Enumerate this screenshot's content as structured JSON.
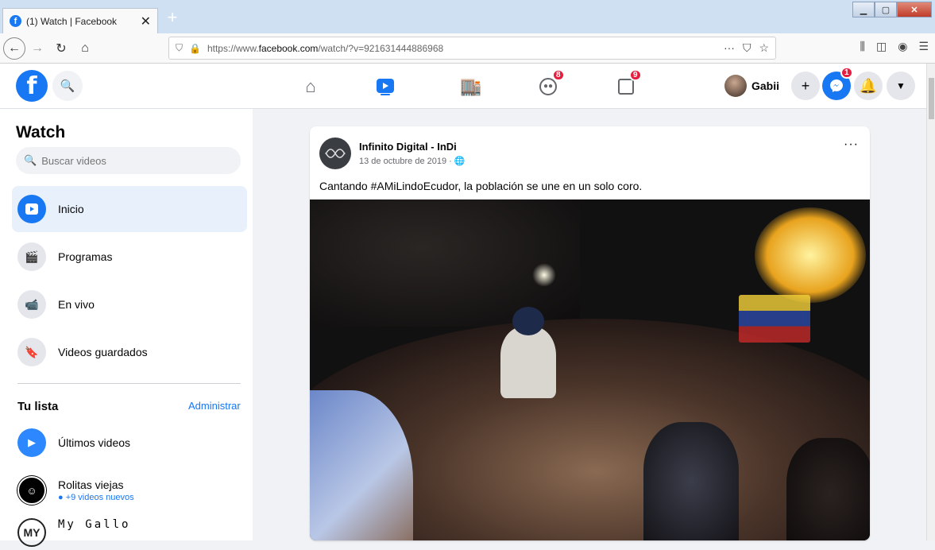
{
  "browser": {
    "tab_title": "(1) Watch | Facebook",
    "tab_close": "✕",
    "new_tab": "+",
    "url_prefix": "https://www.",
    "url_domain": "facebook.com",
    "url_path": "/watch/?v=921631444886968",
    "url_more": "···"
  },
  "fb": {
    "logo": "f",
    "profile_name": "Gabii",
    "badges": {
      "groups": "8",
      "gaming": "9",
      "messenger": "1"
    }
  },
  "sidebar": {
    "title": "Watch",
    "search_placeholder": "Buscar videos",
    "items": [
      {
        "label": "Inicio"
      },
      {
        "label": "Programas"
      },
      {
        "label": "En vivo"
      },
      {
        "label": "Videos guardados"
      }
    ],
    "list_title": "Tu lista",
    "manage": "Administrar",
    "subscriptions": [
      {
        "name": "Últimos videos",
        "note": ""
      },
      {
        "name": "Rolitas viejas",
        "note": "● +9 videos nuevos"
      },
      {
        "name": "My Gallo",
        "note": "",
        "avatar_text": "MY"
      }
    ]
  },
  "post": {
    "author": "Infinito Digital - InDi",
    "date": "13 de octubre de 2019 · 🌐",
    "more": "···",
    "text": "Cantando #AMiLindoEcudor, la población se une en un solo coro."
  }
}
